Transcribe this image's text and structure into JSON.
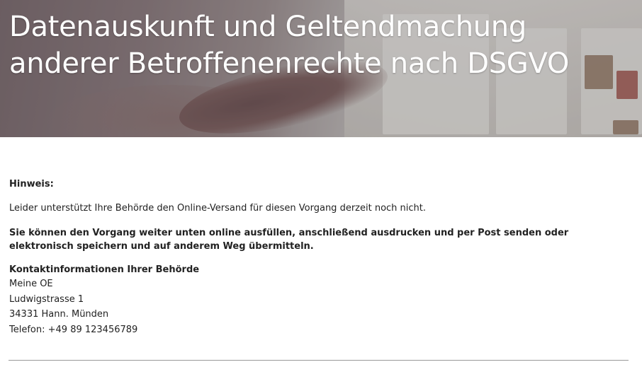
{
  "header": {
    "title_line1": "Datenauskunft und Geltendmachung",
    "title_line2": "anderer Betroffenenrechte nach DSGVO"
  },
  "notice": {
    "label": "Hinweis:",
    "info_text": "Leider unterstützt Ihre Behörde den Online-Versand für diesen Vorgang derzeit noch nicht.",
    "instruction_text": "Sie können den Vorgang weiter unten online ausfüllen, anschließend ausdrucken und per Post senden oder elektronisch speichern und auf anderem Weg übermitteln."
  },
  "contact": {
    "heading": "Kontaktinformationen Ihrer Behörde",
    "name": "Meine OE",
    "street": "Ludwigstrasse 1",
    "city": "34331 Hann. Münden",
    "phone": "Telefon: +49 89 123456789"
  }
}
